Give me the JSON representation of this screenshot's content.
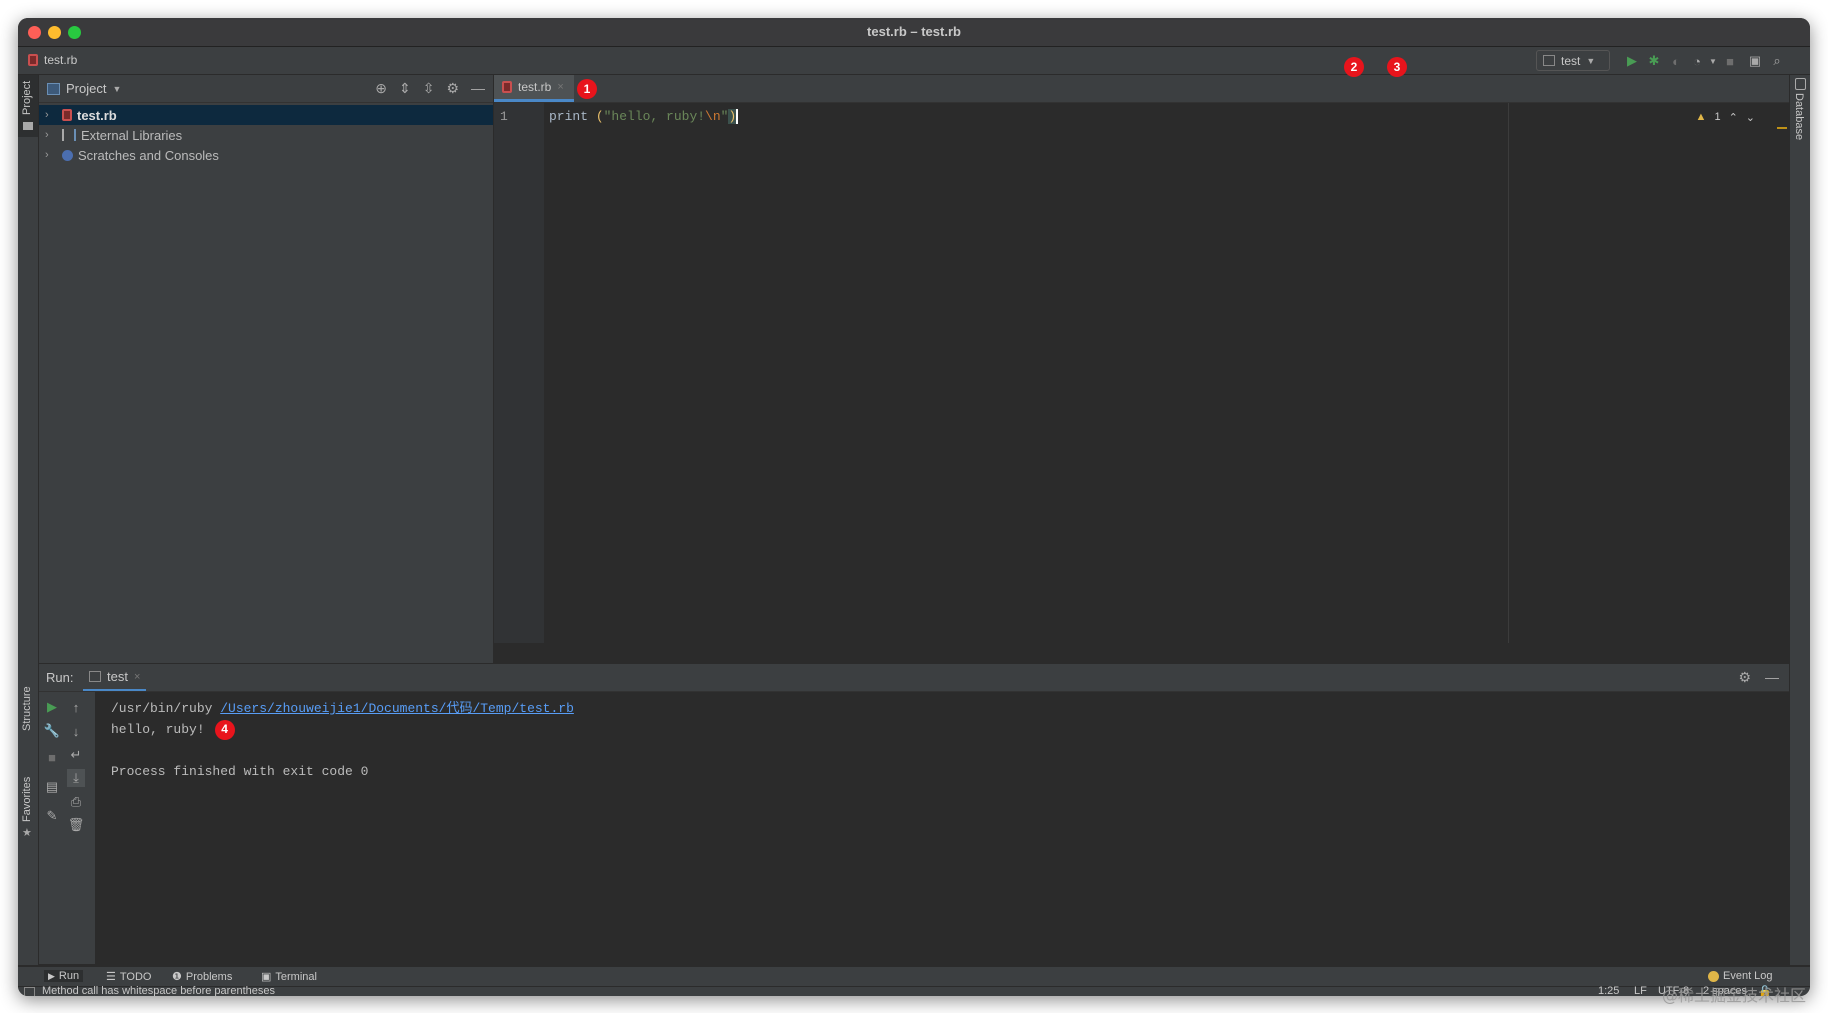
{
  "window": {
    "title": "test.rb – test.rb"
  },
  "navbar": {
    "breadcrumb": "test.rb",
    "run_config": "test"
  },
  "left_strip": {
    "project_label": "Project",
    "structure_label": "Structure",
    "favorites_label": "Favorites"
  },
  "right_strip": {
    "database_label": "Database"
  },
  "project_panel": {
    "title": "Project",
    "tree": [
      {
        "label": "test.rb",
        "selected": true,
        "bold": true
      },
      {
        "label": "External Libraries",
        "selected": false,
        "bold": false
      },
      {
        "label": "Scratches and Consoles",
        "selected": false,
        "bold": false
      }
    ]
  },
  "editor": {
    "tab_label": "test.rb",
    "line_number": "1",
    "code": {
      "keyword": "print",
      "paren_open": " (",
      "string_a": "\"hello, ruby!",
      "escape": "\\n",
      "string_b": "\"",
      "paren_close": ")"
    },
    "warning_count": "1"
  },
  "annotations": {
    "one": "1",
    "two": "2",
    "three": "3",
    "four": "4"
  },
  "run_panel": {
    "label": "Run:",
    "tab_label": "test",
    "console": {
      "line1_prefix": "/usr/bin/ruby ",
      "line1_link": "/Users/zhouweijie1/Documents/代码/Temp/test.rb",
      "line2": "hello, ruby!",
      "line4": "Process finished with exit code 0"
    }
  },
  "bottom_tabs": {
    "run": "Run",
    "todo": "TODO",
    "problems": "Problems",
    "terminal": "Terminal",
    "event_log": "Event Log"
  },
  "status_bar": {
    "message": "Method call has whitespace before parentheses",
    "position": "1:25",
    "line_sep": "LF",
    "encoding": "UTF-8",
    "indent": "2 spaces"
  },
  "watermark": "@稀土掘金技术社区",
  "colors": {
    "accent": "#4a88c7",
    "badge": "#e8141c",
    "run_green": "#499c54"
  }
}
